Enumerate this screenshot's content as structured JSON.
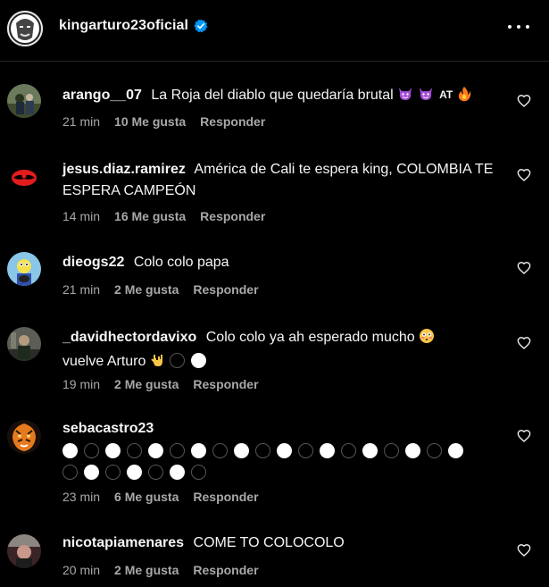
{
  "header": {
    "username": "kingarturo23oficial",
    "verified": true
  },
  "colors": {
    "background": "#000000",
    "text": "#f5f5f5",
    "meta": "#a8a8a8",
    "verified": "#0095f6"
  },
  "comments": [
    {
      "user": "arango__07",
      "text": "La Roja del diablo que quedaría brutal",
      "emojis": [
        "smiling-imp-emoji",
        "smiling-imp-emoji",
        "at-symbol",
        "fire-emoji"
      ],
      "emoji_text": "AT",
      "time": "21 min",
      "likes": "10 Me gusta",
      "reply": "Responder"
    },
    {
      "user": "jesus.diaz.ramirez",
      "text": "América de Cali te espera king, COLOMBIA TE ESPERA CAMPEÓN",
      "time": "14 min",
      "likes": "16 Me gusta",
      "reply": "Responder"
    },
    {
      "user": "dieogs22",
      "text": "Colo colo papa",
      "time": "21 min",
      "likes": "2 Me gusta",
      "reply": "Responder"
    },
    {
      "user": "_davidhectordavixo",
      "text": "Colo colo ya ah esperado mucho",
      "text2": "vuelve Arturo",
      "emojis": [
        "flushed-emoji",
        "love-you-gesture-emoji",
        "black-circle",
        "white-circle"
      ],
      "time": "19 min",
      "likes": "2 Me gusta",
      "reply": "Responder"
    },
    {
      "user": "sebacastro23",
      "text": "",
      "circles_row1": [
        "w",
        "b",
        "w",
        "b",
        "w",
        "b",
        "w",
        "b",
        "w",
        "b",
        "w",
        "b",
        "w",
        "b",
        "w",
        "b",
        "w",
        "b",
        "w"
      ],
      "circles_row2": [
        "b",
        "w",
        "b",
        "w",
        "b",
        "w",
        "b"
      ],
      "time": "23 min",
      "likes": "6 Me gusta",
      "reply": "Responder"
    },
    {
      "user": "nicotapiamenares",
      "text": "COME TO COLOCOLO",
      "time": "20 min",
      "likes": "2 Me gusta",
      "reply": "Responder"
    }
  ]
}
